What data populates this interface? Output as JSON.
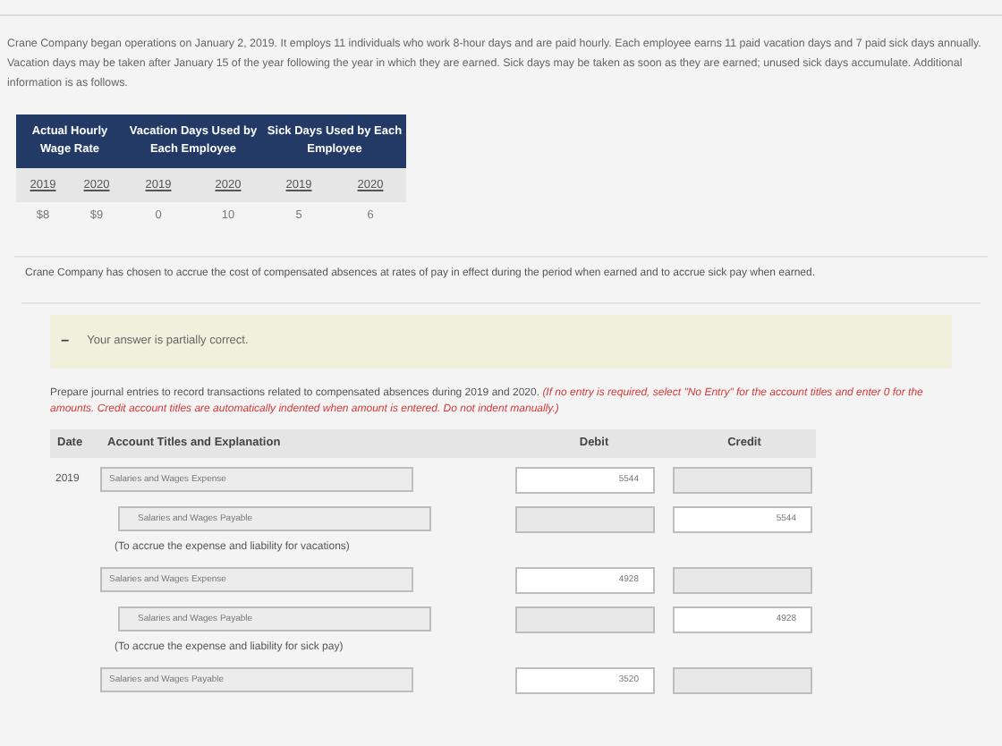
{
  "intro": "Crane Company began operations on January 2, 2019. It employs 11 individuals who work 8-hour days and are paid hourly. Each employee earns 11 paid vacation days and 7 paid sick days annually. Vacation days may be taken after January 15 of the year following the year in which they are earned. Sick days may be taken as soon as they are earned; unused sick days accumulate. Additional information is as follows.",
  "info_table": {
    "groups": [
      "Actual Hourly Wage Rate",
      "Vacation Days Used by Each Employee",
      "Sick Days Used by Each Employee"
    ],
    "years": [
      "2019",
      "2020",
      "2019",
      "2020",
      "2019",
      "2020"
    ],
    "values": [
      "$8",
      "$9",
      "0",
      "10",
      "5",
      "6"
    ]
  },
  "policy": "Crane Company has chosen to accrue the cost of compensated absences at rates of pay in effect during the period when earned and to accrue sick pay when earned.",
  "feedback": {
    "icon": "−",
    "message": "Your answer is partially correct."
  },
  "prompt": {
    "text": "Prepare journal entries to record transactions related to compensated absences during 2019 and 2020.",
    "instruction": "(If no entry is required, select \"No Entry\" for the account titles and enter 0 for the amounts. Credit account titles are automatically indented when amount is entered. Do not indent manually.)"
  },
  "journal": {
    "columns": [
      "Date",
      "Account Titles and Explanation",
      "Debit",
      "Credit"
    ],
    "rows": [
      {
        "kind": "entry",
        "date": "2019",
        "account": "Salaries and Wages Expense",
        "debit": "5544",
        "credit": ""
      },
      {
        "kind": "entry",
        "date": "",
        "account": "Salaries and Wages Payable",
        "debit": "",
        "credit": "5544"
      },
      {
        "kind": "note",
        "text": "(To accrue the expense and liability for vacations)"
      },
      {
        "kind": "entry",
        "date": "",
        "account": "Salaries and Wages Expense",
        "debit": "4928",
        "credit": ""
      },
      {
        "kind": "entry",
        "date": "",
        "account": "Salaries and Wages Payable",
        "debit": "",
        "credit": "4928"
      },
      {
        "kind": "note",
        "text": "(To accrue the expense and liability for sick pay)"
      },
      {
        "kind": "entry",
        "date": "",
        "account": "Salaries and Wages Payable",
        "debit": "3520",
        "credit": ""
      }
    ]
  }
}
